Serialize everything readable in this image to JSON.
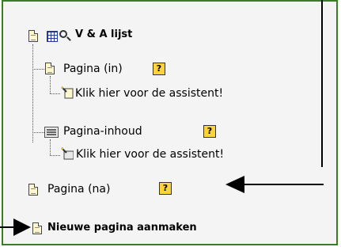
{
  "tree": {
    "root_label": "V & A lijst",
    "before_label": "Pagina (in)",
    "before_assistant": "Klik hier voor de assistent!",
    "content_label": "Pagina-inhoud",
    "content_assistant": "Klik hier voor de assistent!",
    "after_label": "Pagina (na)",
    "new_page_label": "Nieuwe pagina aanmaken",
    "help_glyph": "?"
  },
  "icons": {
    "page": "page-icon",
    "table": "table-icon",
    "search": "search-icon",
    "help": "help-icon",
    "wizard": "wizard-icon",
    "content": "content-icon",
    "new_page": "new-page-icon"
  },
  "colors": {
    "panel_border": "#3a7d24",
    "panel_bg": "#f4f4f4",
    "help_bg": "#ffd43b",
    "arrow": "#000000"
  }
}
